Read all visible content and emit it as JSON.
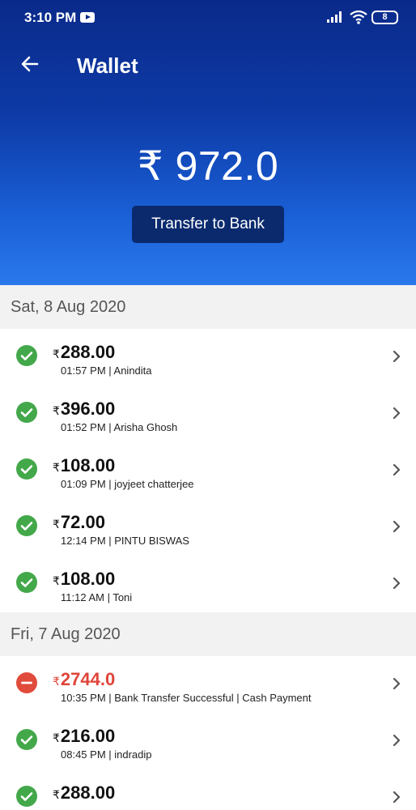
{
  "status_bar": {
    "time": "3:10 PM",
    "battery": "8"
  },
  "header": {
    "title": "Wallet",
    "balance": "₹ 972.0",
    "transfer_label": "Transfer to Bank"
  },
  "sections": [
    {
      "date": "Sat, 8 Aug 2020",
      "transactions": [
        {
          "status": "success",
          "currency": "₹",
          "amount": "288.00",
          "detail": "01:57 PM | Anindita"
        },
        {
          "status": "success",
          "currency": "₹",
          "amount": "396.00",
          "detail": "01:52 PM | Arisha Ghosh"
        },
        {
          "status": "success",
          "currency": "₹",
          "amount": "108.00",
          "detail": "01:09 PM | joyjeet chatterjee"
        },
        {
          "status": "success",
          "currency": "₹",
          "amount": "72.00",
          "detail": "12:14 PM | PINTU BISWAS"
        },
        {
          "status": "success",
          "currency": "₹",
          "amount": "108.00",
          "detail": "11:12 AM | Toni"
        }
      ]
    },
    {
      "date": "Fri, 7 Aug 2020",
      "transactions": [
        {
          "status": "debit",
          "currency": "₹",
          "amount": "2744.0",
          "detail": "10:35 PM | Bank Transfer Successful | Cash Payment"
        },
        {
          "status": "success",
          "currency": "₹",
          "amount": "216.00",
          "detail": "08:45 PM | indradip"
        },
        {
          "status": "success",
          "currency": "₹",
          "amount": "288.00",
          "detail": ""
        }
      ]
    }
  ],
  "colors": {
    "success": "#43a84a",
    "debit": "#e14b3b",
    "header_top": "#0a2a8a",
    "button": "#0b2a6e"
  },
  "icons": {
    "status_ok": "check-circle-icon",
    "status_debit": "minus-circle-icon",
    "back": "arrow-left-icon",
    "row_action": "chevron-right-icon"
  }
}
